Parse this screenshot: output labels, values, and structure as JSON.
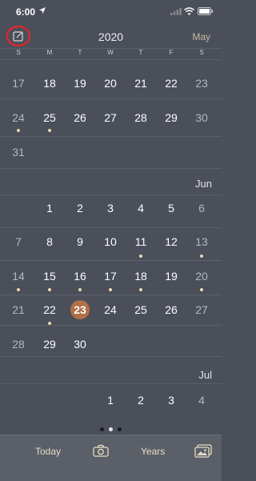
{
  "status_bar": {
    "time": "6:00"
  },
  "header": {
    "year": "2020",
    "month_link": "May"
  },
  "weekdays": [
    "S",
    "M",
    "T",
    "W",
    "T",
    "F",
    "S"
  ],
  "month_labels": {
    "june": "Jun",
    "july": "Jul"
  },
  "calendar": {
    "may_week3": [
      "17",
      "18",
      "19",
      "20",
      "21",
      "22",
      "23"
    ],
    "may_week4": [
      "24",
      "25",
      "26",
      "27",
      "28",
      "29",
      "30"
    ],
    "may_week5": [
      "31"
    ],
    "jun_week1": [
      "1",
      "2",
      "3",
      "4",
      "5",
      "6"
    ],
    "jun_week2": [
      "7",
      "8",
      "9",
      "10",
      "11",
      "12",
      "13"
    ],
    "jun_week3": [
      "14",
      "15",
      "16",
      "17",
      "18",
      "19",
      "20"
    ],
    "jun_week4": [
      "21",
      "22",
      "23",
      "24",
      "25",
      "26",
      "27"
    ],
    "jun_week5": [
      "28",
      "29",
      "30"
    ],
    "jul_week1": [
      "1",
      "2",
      "3",
      "4"
    ],
    "today": "23"
  },
  "pager": {
    "count": 3,
    "active_index": 1
  },
  "tab_bar": {
    "today_label": "Today",
    "years_label": "Years"
  },
  "colors": {
    "background": "#4a4f5a",
    "accent_today": "#b06f47",
    "entry_dot": "#e7d8b4",
    "annotation_circle": "#e2262c"
  },
  "icons": [
    "location-arrow-icon",
    "signal-icon",
    "wifi-icon",
    "battery-icon",
    "compose-icon",
    "camera-icon",
    "gallery-icon"
  ]
}
